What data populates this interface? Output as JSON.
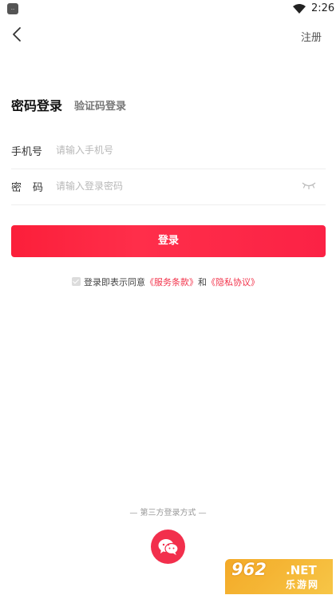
{
  "status_bar": {
    "app_icon_text": "...",
    "time": "2:26"
  },
  "header": {
    "register_label": "注册"
  },
  "tabs": {
    "password_login": "密码登录",
    "code_login": "验证码登录"
  },
  "form": {
    "phone_label": "手机号",
    "phone_placeholder": "请输入手机号",
    "password_label": "密码",
    "password_placeholder": "请输入登录密码"
  },
  "login_button": "登录",
  "agreement": {
    "prefix": "登录即表示同意",
    "terms": "《服务条款》",
    "and": "和",
    "privacy": "《隐私协议》"
  },
  "third_party": {
    "title": "— 第三方登录方式 —"
  },
  "watermark": {
    "number": "962",
    "net": ".NET",
    "cn": "乐游网"
  },
  "colors": {
    "accent": "#f22f4c",
    "button": "#fb1f3a"
  }
}
